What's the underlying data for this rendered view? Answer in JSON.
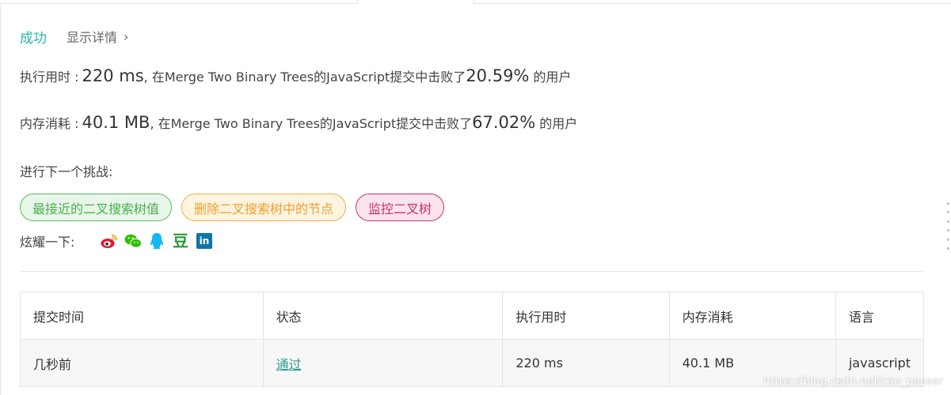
{
  "status": {
    "result": "成功",
    "details_link": "显示详情",
    "chevron": "›"
  },
  "runtime": {
    "label": "执行用时 :",
    "value": "220 ms",
    "text": ", 在Merge Two Binary Trees的JavaScript提交中击败了",
    "percent": "20.59%",
    "suffix": "的用户"
  },
  "memory": {
    "label": "内存消耗 :",
    "value": "40.1 MB",
    "text": ", 在Merge Two Binary Trees的JavaScript提交中击败了",
    "percent": "67.02%",
    "suffix": "的用户"
  },
  "challenge": {
    "title": "进行下一个挑战:",
    "tags": [
      {
        "label": "最接近的二叉搜索树值",
        "color": "green"
      },
      {
        "label": "删除二叉搜索树中的节点",
        "color": "orange"
      },
      {
        "label": "监控二叉树",
        "color": "pink"
      }
    ]
  },
  "share": {
    "label": "炫耀一下:",
    "icons": [
      "weibo-icon",
      "wechat-icon",
      "qq-icon",
      "douban-icon",
      "linkedin-icon"
    ],
    "douban_glyph": "豆",
    "linkedin_glyph": "in",
    "colors": {
      "weibo": "#e6162d",
      "wechat": "#2dc100",
      "qq": "#12b7f5",
      "douban": "#2e963d",
      "linkedin": "#0e76a8"
    }
  },
  "submissions": {
    "headers": [
      "提交时间",
      "状态",
      "执行用时",
      "内存消耗",
      "语言"
    ],
    "rows": [
      {
        "time": "几秒前",
        "status": "通过",
        "runtime": "220 ms",
        "memory": "40.1 MB",
        "language": "javascript"
      }
    ]
  },
  "watermark": "https://blog.csdn.net/csu_passer"
}
